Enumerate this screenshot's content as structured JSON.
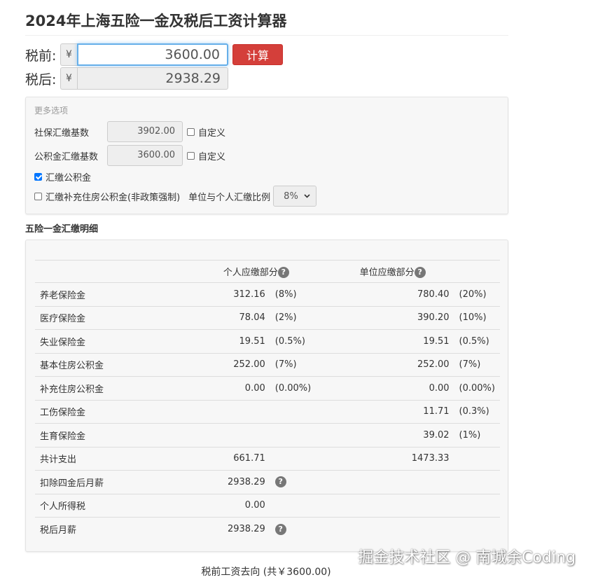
{
  "title": "2024年上海五险一金及税后工资计算器",
  "pretax": {
    "label": "税前:",
    "currency": "¥",
    "value": "3600.00",
    "button": "计算"
  },
  "posttax": {
    "label": "税后:",
    "currency": "¥",
    "value": "2938.29"
  },
  "options": {
    "title": "更多选项",
    "social_base": {
      "label": "社保汇缴基数",
      "value": "3902.00",
      "custom_label": "自定义"
    },
    "fund_base": {
      "label": "公积金汇缴基数",
      "value": "3600.00",
      "custom_label": "自定义"
    },
    "pay_fund": {
      "label": "汇缴公积金",
      "checked": true
    },
    "supp_fund": {
      "label": "汇缴补充住房公积金(非政策强制)",
      "checked": false
    },
    "ratio_label": "单位与个人汇缴比例",
    "ratio_value": "8%"
  },
  "detail": {
    "section_title": "五险一金汇缴明细",
    "headers": {
      "personal": "个人应缴部分",
      "company": "单位应缴部分",
      "help": "?"
    },
    "rows": [
      {
        "name": "养老保险金",
        "p_amt": "312.16",
        "p_pct": "(8%)",
        "c_amt": "780.40",
        "c_pct": "(20%)"
      },
      {
        "name": "医疗保险金",
        "p_amt": "78.04",
        "p_pct": "(2%)",
        "c_amt": "390.20",
        "c_pct": "(10%)"
      },
      {
        "name": "失业保险金",
        "p_amt": "19.51",
        "p_pct": "(0.5%)",
        "c_amt": "19.51",
        "c_pct": "(0.5%)"
      },
      {
        "name": "基本住房公积金",
        "p_amt": "252.00",
        "p_pct": "(7%)",
        "c_amt": "252.00",
        "c_pct": "(7%)"
      },
      {
        "name": "补充住房公积金",
        "p_amt": "0.00",
        "p_pct": "(0.00%)",
        "c_amt": "0.00",
        "c_pct": "(0.00%)"
      },
      {
        "name": "工伤保险金",
        "p_amt": "",
        "p_pct": "",
        "c_amt": "11.71",
        "c_pct": "(0.3%)"
      },
      {
        "name": "生育保险金",
        "p_amt": "",
        "p_pct": "",
        "c_amt": "39.02",
        "c_pct": "(1%)"
      }
    ],
    "summary": [
      {
        "name": "共计支出",
        "p_amt": "661.71",
        "c_amt": "1473.33"
      },
      {
        "name": "扣除四金后月薪",
        "p_amt": "2938.29",
        "help": "?"
      },
      {
        "name": "个人所得税",
        "p_amt": "0.00"
      },
      {
        "name": "税后月薪",
        "p_amt": "2938.29",
        "help": "?"
      }
    ]
  },
  "footer_caption": "税前工资去向 (共￥3600.00)",
  "watermark": "掘金技术社区 @ 南城余Coding"
}
